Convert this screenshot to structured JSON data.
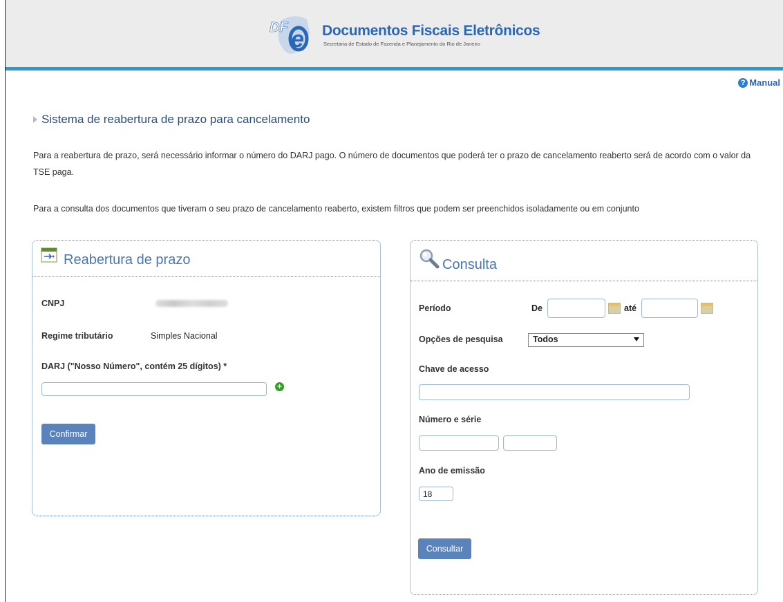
{
  "header": {
    "title": "Documentos Fiscais Eletrônicos",
    "subtitle": "Secretaria de Estado de Fazenda e Planejamento do Rio de Janeiro",
    "logo_text": "DFe"
  },
  "manual_label": "Manual",
  "section_title": "Sistema de reabertura de prazo para cancelamento",
  "paragraphs": {
    "p1": "Para a reabertura de prazo, será necessário informar o número do DARJ pago. O número de documentos que poderá ter o prazo de cancelamento reaberto será de acordo com o valor da TSE paga.",
    "p2": "Para a consulta dos documentos que tiveram o seu prazo de cancelamento reaberto, existem filtros que podem ser preenchidos isoladamente ou em conjunto"
  },
  "reabertura": {
    "title": "Reabertura de prazo",
    "cnpj_label": "CNPJ",
    "regime_label": "Regime tributário",
    "regime_value": "Simples Nacional",
    "darj_label": "DARJ (\"Nosso Número\", contém 25 dígitos) *",
    "darj_value": "",
    "confirm_button": "Confirmar"
  },
  "consulta": {
    "title": "Consulta",
    "periodo_label": "Período",
    "de_label": "De",
    "ate_label": "até",
    "de_value": "",
    "ate_value": "",
    "opcoes_label": "Opções de pesquisa",
    "opcoes_selected": "Todos",
    "chave_label": "Chave de acesso",
    "chave_value": "",
    "numero_serie_label": "Número e série",
    "numero_value": "",
    "serie_value": "",
    "ano_label": "Ano de emissão",
    "ano_value": "18",
    "consultar_button": "Consultar"
  },
  "colors": {
    "accent": "#2a9ad6",
    "title_blue": "#4c75b5",
    "button": "#5a82bb",
    "add_green": "#2da11f"
  }
}
